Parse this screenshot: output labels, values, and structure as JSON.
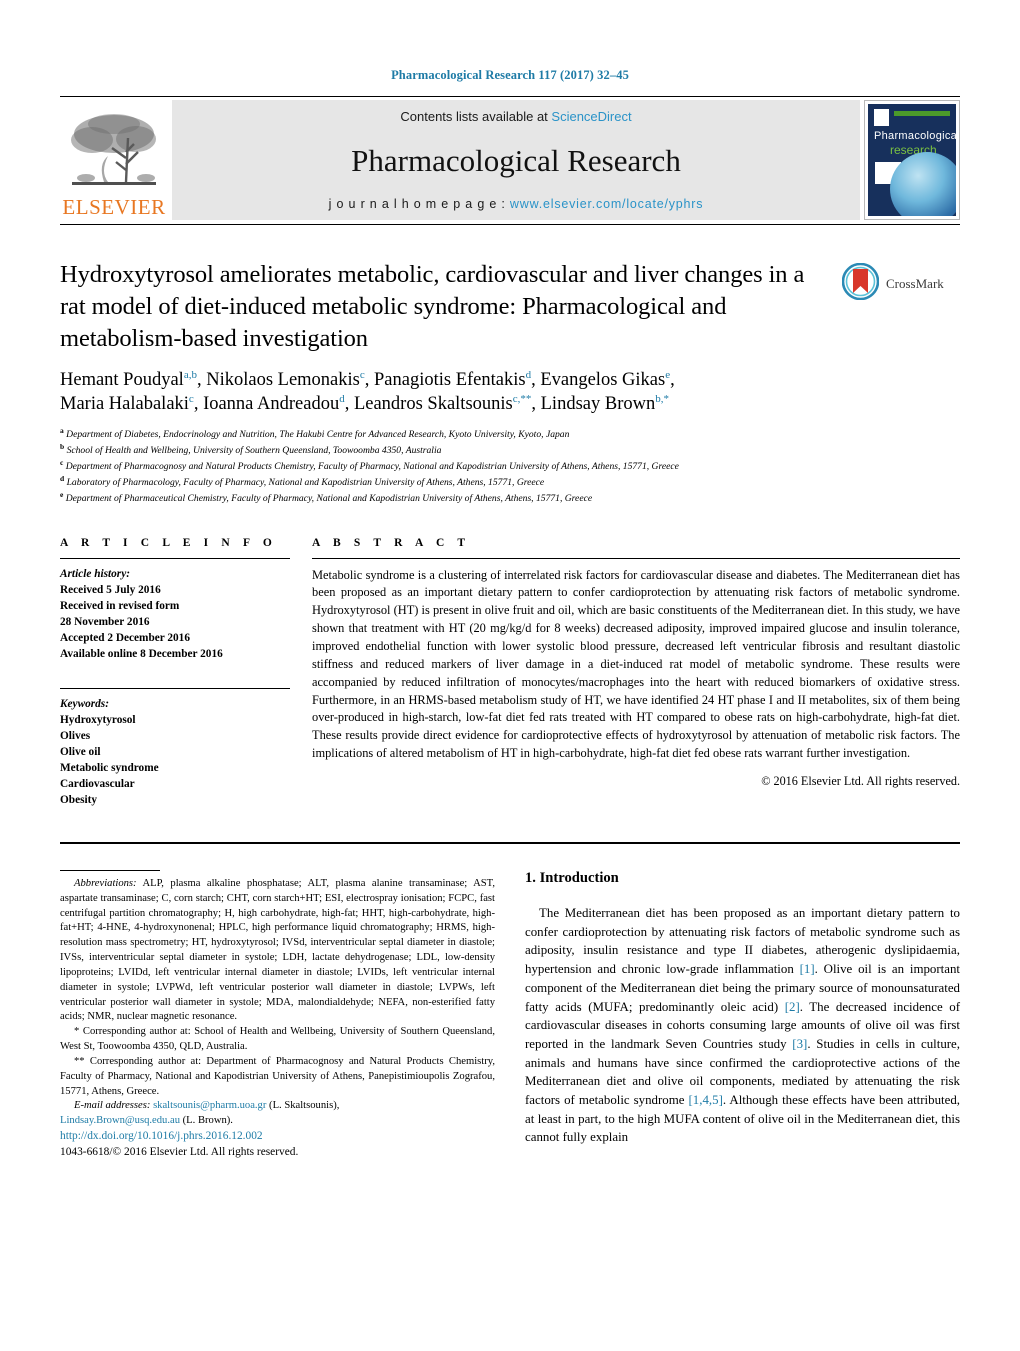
{
  "running_head": "Pharmacological Research 117 (2017) 32–45",
  "masthead": {
    "contents_prefix": "Contents lists available at ",
    "sciencedirect": "ScienceDirect",
    "journal_title": "Pharmacological Research",
    "homepage_prefix": "j o u r n a l   h o m e p a g e :  ",
    "homepage_url": "www.elsevier.com/locate/yphrs",
    "publisher": "ELSEVIER",
    "publisher_icon": "elsevier-tree-icon",
    "cover": {
      "line1": "Pharmacological",
      "line2": "research",
      "icon": "journal-cover-thumbnail"
    }
  },
  "crossmark": {
    "label": "CrossMark",
    "icon": "crossmark-icon"
  },
  "article": {
    "title": "Hydroxytyrosol ameliorates metabolic, cardiovascular and liver changes in a rat model of diet-induced metabolic syndrome: Pharmacological and metabolism-based investigation",
    "authors_line1": "Hemant Poudyal<sup>a,b</sup>, Nikolaos Lemonakis<sup>c</sup>, Panagiotis Efentakis<sup>d</sup>, Evangelos Gikas<sup>e</sup>,",
    "authors_line2": "Maria Halabalaki<sup>c</sup>, Ioanna Andreadou<sup>d</sup>, Leandros Skaltsounis<sup>c,**</sup>, Lindsay Brown<sup>b,*</sup>",
    "affiliations": [
      {
        "marker": "a",
        "text": "Department of Diabetes, Endocrinology and Nutrition, The Hakubi Centre for Advanced Research, Kyoto University, Kyoto, Japan"
      },
      {
        "marker": "b",
        "text": "School of Health and Wellbeing, University of Southern Queensland, Toowoomba 4350, Australia"
      },
      {
        "marker": "c",
        "text": "Department of Pharmacognosy and Natural Products Chemistry, Faculty of Pharmacy, National and Kapodistrian University of Athens, Athens, 15771, Greece"
      },
      {
        "marker": "d",
        "text": "Laboratory of Pharmacology, Faculty of Pharmacy, National and Kapodistrian University of Athens, Athens, 15771, Greece"
      },
      {
        "marker": "e",
        "text": "Department of Pharmaceutical Chemistry, Faculty of Pharmacy, National and Kapodistrian University of Athens, Athens, 15771, Greece"
      }
    ]
  },
  "article_info": {
    "heading": "A R T I C L E   I N F O",
    "history_label": "Article history:",
    "history": [
      "Received 5 July 2016",
      "Received in revised form",
      "28 November 2016",
      "Accepted 2 December 2016",
      "Available online 8 December 2016"
    ],
    "keywords_label": "Keywords:",
    "keywords": [
      "Hydroxytyrosol",
      "Olives",
      "Olive oil",
      "Metabolic syndrome",
      "Cardiovascular",
      "Obesity"
    ]
  },
  "abstract": {
    "heading": "A B S T R A C T",
    "text": "Metabolic syndrome is a clustering of interrelated risk factors for cardiovascular disease and diabetes. The Mediterranean diet has been proposed as an important dietary pattern to confer cardioprotection by attenuating risk factors of metabolic syndrome. Hydroxytyrosol (HT) is present in olive fruit and oil, which are basic constituents of the Mediterranean diet. In this study, we have shown that treatment with HT (20 mg/kg/d for 8 weeks) decreased adiposity, improved impaired glucose and insulin tolerance, improved endothelial function with lower systolic blood pressure, decreased left ventricular fibrosis and resultant diastolic stiffness and reduced markers of liver damage in a diet-induced rat model of metabolic syndrome. These results were accompanied by reduced infiltration of monocytes/macrophages into the heart with reduced biomarkers of oxidative stress. Furthermore, in an HRMS-based metabolism study of HT, we have identified 24 HT phase I and II metabolites, six of them being over-produced in high-starch, low-fat diet fed rats treated with HT compared to obese rats on high-carbohydrate, high-fat diet. These results provide direct evidence for cardioprotective effects of hydroxytyrosol by attenuation of metabolic risk factors. The implications of altered metabolism of HT in high-carbohydrate, high-fat diet fed obese rats warrant further investigation.",
    "copyright": "© 2016 Elsevier Ltd. All rights reserved."
  },
  "footnotes": {
    "abbreviations_label": "Abbreviations:",
    "abbreviations_text": " ALP, plasma alkaline phosphatase; ALT, plasma alanine transaminase; AST, aspartate transaminase; C, corn starch; CHT, corn starch+HT; ESI, electrospray ionisation; FCPC, fast centrifugal partition chromatography; H, high carbohydrate, high-fat; HHT, high-carbohydrate, high-fat+HT; 4-HNE, 4-hydroxynonenal; HPLC, high performance liquid chromatography; HRMS, high-resolution mass spectrometry; HT, hydroxytyrosol; IVSd, interventricular septal diameter in diastole; IVSs, interventricular septal diameter in systole; LDH, lactate dehydrogenase; LDL, low-density lipoproteins; LVIDd, left ventricular internal diameter in diastole; LVIDs, left ventricular internal diameter in systole; LVPWd, left ventricular posterior wall diameter in diastole; LVPWs, left ventricular posterior wall diameter in systole; MDA, malondialdehyde; NEFA, non-esterified fatty acids; NMR, nuclear magnetic resonance.",
    "corresponding1": "* Corresponding author at: School of Health and Wellbeing, University of Southern Queensland, West St, Toowoomba 4350, QLD, Australia.",
    "corresponding2": "** Corresponding author at: Department of Pharmacognosy and Natural Products Chemistry, Faculty of Pharmacy, National and Kapodistrian University of Athens, Panepistimioupolis Zografou, 15771, Athens, Greece.",
    "email_label": "E-mail addresses:",
    "email1": "skaltsounis@pharm.uoa.gr",
    "email1_attrib": " (L. Skaltsounis),",
    "email2": "Lindsay.Brown@usq.edu.au",
    "email2_attrib": " (L. Brown).",
    "doi": "http://dx.doi.org/10.1016/j.phrs.2016.12.002",
    "issn": "1043-6618/© 2016 Elsevier Ltd. All rights reserved."
  },
  "introduction": {
    "heading": "1. Introduction",
    "paragraph_parts": [
      {
        "t": "The Mediterranean diet has been proposed as an important dietary pattern to confer cardioprotection by attenuating risk factors of metabolic syndrome such as adiposity, insulin resistance and type II diabetes, atherogenic dyslipidaemia, hypertension and chronic low-grade inflammation "
      },
      {
        "r": "[1]"
      },
      {
        "t": ". Olive oil is an important component of the Mediterranean diet being the primary source of monounsaturated fatty acids (MUFA; predominantly oleic acid) "
      },
      {
        "r": "[2]"
      },
      {
        "t": ". The decreased incidence of cardiovascular diseases in cohorts consuming large amounts of olive oil was first reported in the landmark Seven Countries study "
      },
      {
        "r": "[3]"
      },
      {
        "t": ". Studies in cells in culture, animals and humans have since confirmed the cardioprotective actions of the Mediterranean diet and olive oil components, mediated by attenuating the risk factors of metabolic syndrome "
      },
      {
        "r": "[1,4,5]"
      },
      {
        "t": ". Although these effects have been attributed, at least in part, to the high MUFA content of olive oil in the Mediterranean diet, this cannot fully explain"
      }
    ]
  },
  "colors": {
    "link": "#1e7ba6",
    "sciencedirect": "#2a93c8",
    "elsevier_orange": "#E87722",
    "masthead_bg": "#e6e6e6"
  }
}
